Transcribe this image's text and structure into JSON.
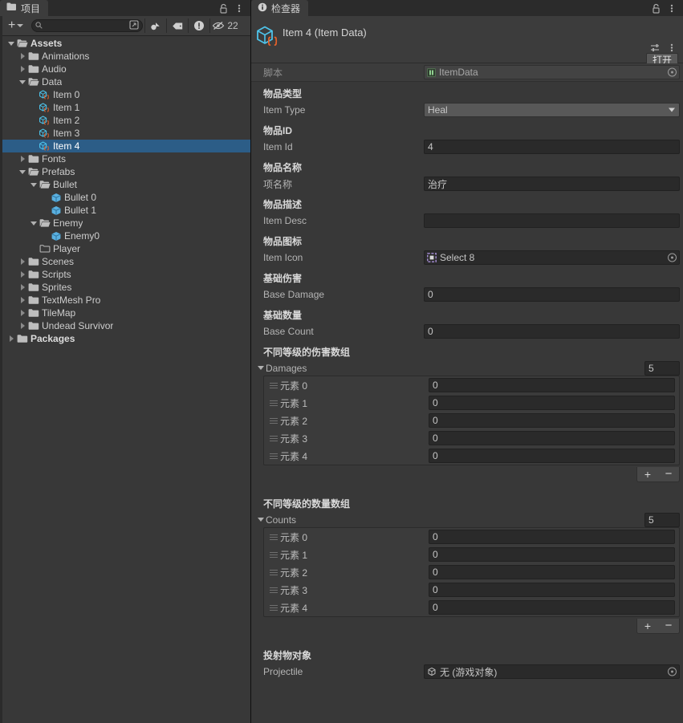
{
  "project_panel": {
    "tab": {
      "label": "项目",
      "icon": "folder-icon"
    },
    "toolbar": {
      "add_label": "+",
      "search_placeholder": "",
      "search_value": "",
      "hidden_count": "22",
      "icons": [
        "search-icon",
        "save-search-icon",
        "favorites-icon",
        "label-icon",
        "warning-icon",
        "hidden-eye-icon"
      ]
    },
    "lock_icon": "lock-open-icon",
    "menu_icon": "kebab-menu-icon",
    "tree": [
      {
        "label": "Assets",
        "depth": 0,
        "state": "expanded",
        "icon": "folder-open-icon",
        "bold": true,
        "selected": false
      },
      {
        "label": "Animations",
        "depth": 1,
        "state": "collapsed",
        "icon": "folder-icon",
        "bold": false,
        "selected": false
      },
      {
        "label": "Audio",
        "depth": 1,
        "state": "collapsed",
        "icon": "folder-icon",
        "bold": false,
        "selected": false
      },
      {
        "label": "Data",
        "depth": 1,
        "state": "expanded",
        "icon": "folder-open-icon",
        "bold": false,
        "selected": false
      },
      {
        "label": "Item 0",
        "depth": 2,
        "state": "leaf",
        "icon": "scriptable-object-icon",
        "bold": false,
        "selected": false
      },
      {
        "label": "Item 1",
        "depth": 2,
        "state": "leaf",
        "icon": "scriptable-object-icon",
        "bold": false,
        "selected": false
      },
      {
        "label": "Item 2",
        "depth": 2,
        "state": "leaf",
        "icon": "scriptable-object-icon",
        "bold": false,
        "selected": false
      },
      {
        "label": "Item 3",
        "depth": 2,
        "state": "leaf",
        "icon": "scriptable-object-icon",
        "bold": false,
        "selected": false
      },
      {
        "label": "Item 4",
        "depth": 2,
        "state": "leaf",
        "icon": "scriptable-object-icon",
        "bold": false,
        "selected": true
      },
      {
        "label": "Fonts",
        "depth": 1,
        "state": "collapsed",
        "icon": "folder-icon",
        "bold": false,
        "selected": false
      },
      {
        "label": "Prefabs",
        "depth": 1,
        "state": "expanded",
        "icon": "folder-open-icon",
        "bold": false,
        "selected": false
      },
      {
        "label": "Bullet",
        "depth": 2,
        "state": "expanded",
        "icon": "folder-open-icon",
        "bold": false,
        "selected": false
      },
      {
        "label": "Bullet 0",
        "depth": 3,
        "state": "leaf",
        "icon": "prefab-icon",
        "bold": false,
        "selected": false
      },
      {
        "label": "Bullet 1",
        "depth": 3,
        "state": "leaf",
        "icon": "prefab-icon",
        "bold": false,
        "selected": false
      },
      {
        "label": "Enemy",
        "depth": 2,
        "state": "expanded",
        "icon": "folder-open-icon",
        "bold": false,
        "selected": false
      },
      {
        "label": "Enemy0",
        "depth": 3,
        "state": "leaf",
        "icon": "prefab-icon",
        "bold": false,
        "selected": false
      },
      {
        "label": "Player",
        "depth": 2,
        "state": "leaf",
        "icon": "folder-empty-icon",
        "bold": false,
        "selected": false
      },
      {
        "label": "Scenes",
        "depth": 1,
        "state": "collapsed",
        "icon": "folder-icon",
        "bold": false,
        "selected": false
      },
      {
        "label": "Scripts",
        "depth": 1,
        "state": "collapsed",
        "icon": "folder-icon",
        "bold": false,
        "selected": false
      },
      {
        "label": "Sprites",
        "depth": 1,
        "state": "collapsed",
        "icon": "folder-icon",
        "bold": false,
        "selected": false
      },
      {
        "label": "TextMesh Pro",
        "depth": 1,
        "state": "collapsed",
        "icon": "folder-icon",
        "bold": false,
        "selected": false
      },
      {
        "label": "TileMap",
        "depth": 1,
        "state": "collapsed",
        "icon": "folder-icon",
        "bold": false,
        "selected": false
      },
      {
        "label": "Undead Survivor",
        "depth": 1,
        "state": "collapsed",
        "icon": "folder-icon",
        "bold": false,
        "selected": false
      },
      {
        "label": "Packages",
        "depth": 0,
        "state": "collapsed",
        "icon": "folder-icon",
        "bold": true,
        "selected": false
      }
    ]
  },
  "inspector": {
    "tab": {
      "label": "检查器",
      "icon": "info-icon"
    },
    "lock_icon": "lock-open-icon",
    "menu_icon": "kebab-menu-icon",
    "preset_icon": "preset-sliders-icon",
    "object_title": "Item 4 (Item Data)",
    "object_icon": "scriptable-object-icon",
    "open_button": "打开",
    "script": {
      "label": "脚本",
      "value": "ItemData",
      "icon": "cs-script-icon",
      "picker_icon": "object-picker-icon"
    },
    "properties": [
      {
        "tooltip": "物品类型",
        "label": "Item Type",
        "value": "Heal",
        "kind": "dropdown",
        "name": "item-type"
      },
      {
        "tooltip": "物品ID",
        "label": "Item Id",
        "value": "4",
        "kind": "text",
        "name": "item-id"
      },
      {
        "tooltip": "物品名称",
        "label": "项名称",
        "value": "治疗",
        "kind": "text",
        "name": "item-name"
      },
      {
        "tooltip": "物品描述",
        "label": "Item Desc",
        "value": "",
        "kind": "text",
        "name": "item-desc"
      },
      {
        "tooltip": "物品图标",
        "label": "Item Icon",
        "value": "Select 8",
        "kind": "objref",
        "icon": "sprite-icon",
        "name": "item-icon"
      },
      {
        "tooltip": "基础伤害",
        "label": "Base Damage",
        "value": "0",
        "kind": "text",
        "name": "base-damage"
      },
      {
        "tooltip": "基础数量",
        "label": "Base Count",
        "value": "0",
        "kind": "text",
        "name": "base-count"
      }
    ],
    "arrays": [
      {
        "tooltip": "不同等级的伤害数组",
        "label": "Damages",
        "size": "5",
        "name": "damages",
        "elements": [
          {
            "label": "元素 0",
            "value": "0"
          },
          {
            "label": "元素 1",
            "value": "0"
          },
          {
            "label": "元素 2",
            "value": "0"
          },
          {
            "label": "元素 3",
            "value": "0"
          },
          {
            "label": "元素 4",
            "value": "0"
          }
        ],
        "add_label": "+",
        "remove_label": "−"
      },
      {
        "tooltip": "不同等级的数量数组",
        "label": "Counts",
        "size": "5",
        "name": "counts",
        "elements": [
          {
            "label": "元素 0",
            "value": "0"
          },
          {
            "label": "元素 1",
            "value": "0"
          },
          {
            "label": "元素 2",
            "value": "0"
          },
          {
            "label": "元素 3",
            "value": "0"
          },
          {
            "label": "元素 4",
            "value": "0"
          }
        ],
        "add_label": "+",
        "remove_label": "−"
      }
    ],
    "projectile": {
      "tooltip": "投射物对象",
      "label": "Projectile",
      "value": "无 (游戏对象)",
      "icon": "gameobject-icon",
      "picker_icon": "object-picker-icon"
    }
  },
  "colors": {
    "panel_bg": "#383838",
    "header_bg": "#3c3c3c",
    "tabstrip_bg": "#2b2b2b",
    "selection_blue": "#2c5d87",
    "field_bg": "#2a2a2a",
    "dropdown_bg": "#585858",
    "text": "#c4c4c4",
    "icon_cube_blue": "#4ec3ea",
    "icon_braces_orange": "#e8622a",
    "prefab_blue": "#5ab0e0",
    "sprite_purple": "#a88fd8"
  }
}
